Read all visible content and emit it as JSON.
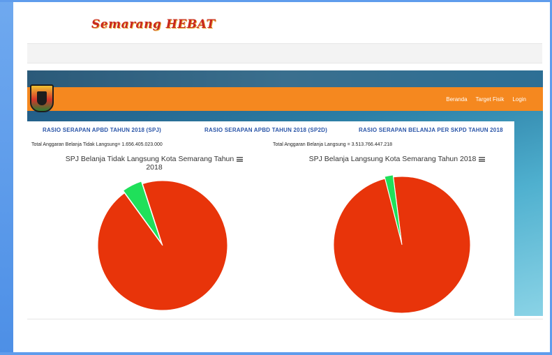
{
  "logo": {
    "text": "Semarang HEBAT"
  },
  "nav": {
    "links": [
      "Beranda",
      "Target Fisik",
      "Login"
    ]
  },
  "tabs": [
    "RASIO SERAPAN APBD TAHUN 2018 (SPJ)",
    "RASIO SERAPAN APBD TAHUN 2018 (SP2D)",
    "RASIO SERAPAN BELANJA PER SKPD TAHUN 2018"
  ],
  "charts": {
    "left": {
      "total_text": "Total Anggaran Belanja Tidak Langsung= 1.656.405.023.000",
      "title_line1": "SPJ Belanja Tidak Langsung Kota Semarang Tahun",
      "title_line2": "2018"
    },
    "right": {
      "total_text": "Total Anggaran Belanja Langsung = 3.513.766.447.218",
      "title_line1": "SPJ Belanja Langsung Kota Semarang Tahun 2018"
    }
  },
  "chart_data": [
    {
      "type": "pie",
      "title": "SPJ Belanja Tidak Langsung Kota Semarang Tahun 2018",
      "slices": [
        {
          "value": 0.95,
          "color": "#e8340a"
        },
        {
          "value": 0.05,
          "color": "#1fe05a"
        }
      ]
    },
    {
      "type": "pie",
      "title": "SPJ Belanja Langsung Kota Semarang Tahun 2018",
      "slices": [
        {
          "value": 0.98,
          "color": "#e8340a"
        },
        {
          "value": 0.02,
          "color": "#1fe05a"
        }
      ]
    }
  ],
  "colors": {
    "navbar": "#f5881f",
    "tab_link": "#2a55a8",
    "pie_main": "#e8340a",
    "pie_small": "#1fe05a"
  }
}
